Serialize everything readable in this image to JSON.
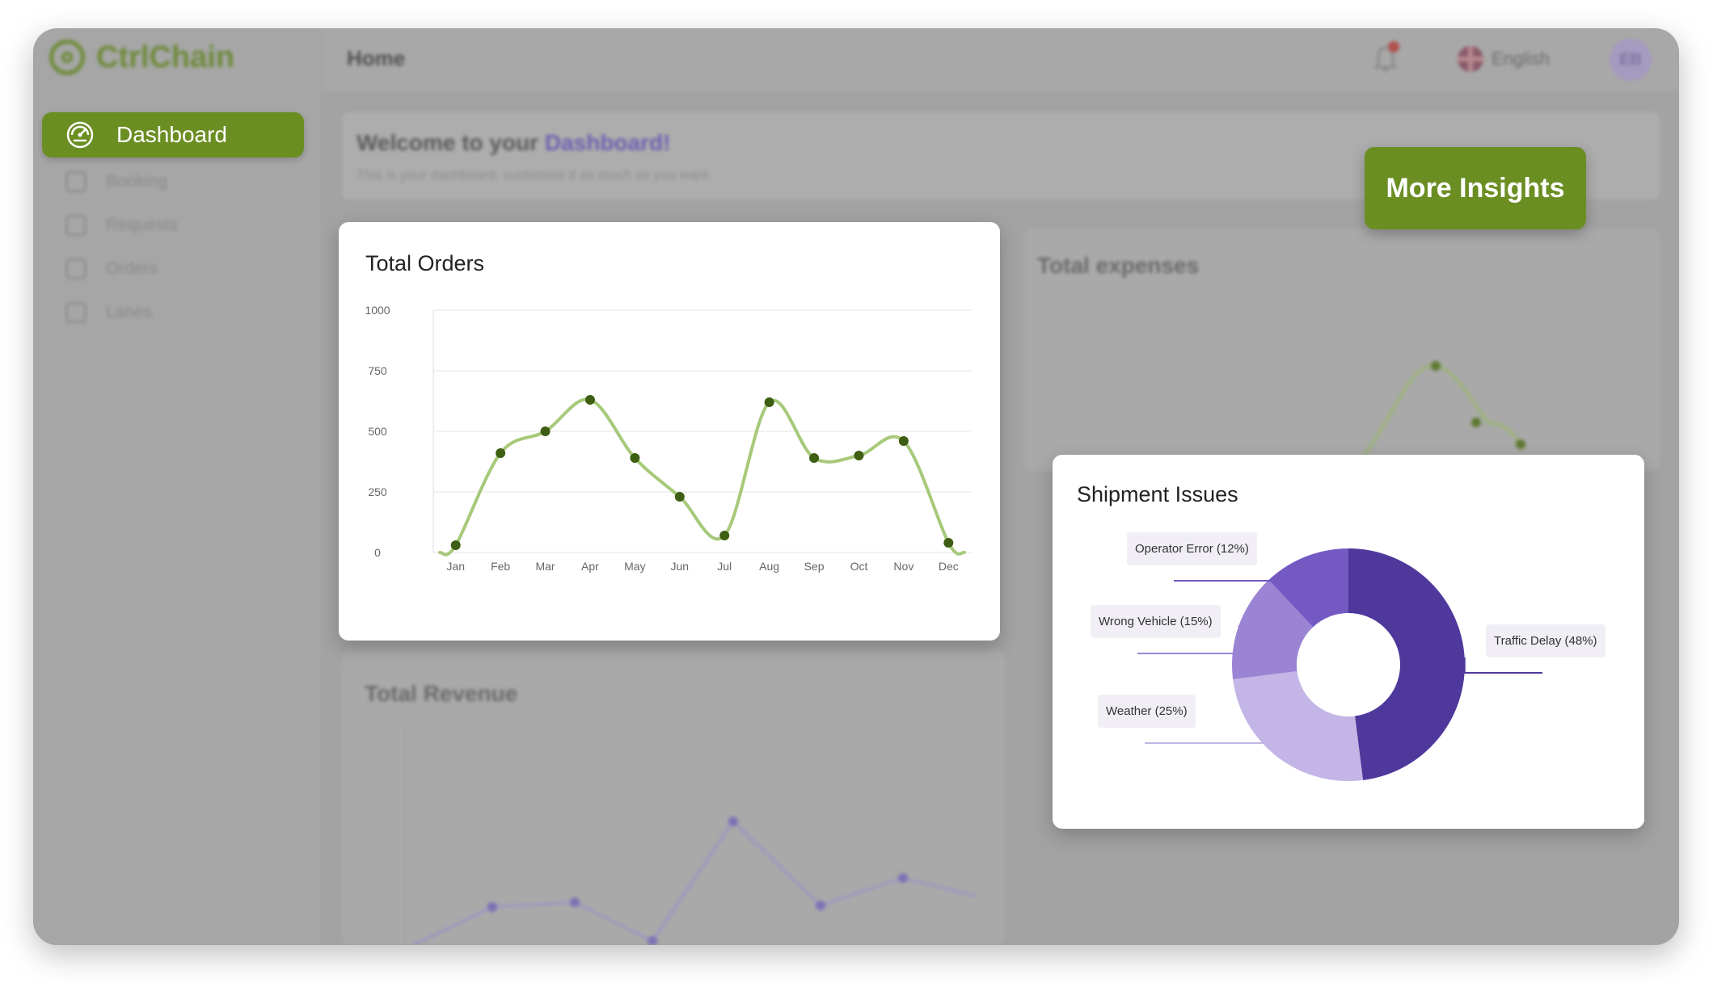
{
  "app": {
    "brand": "CtrlChain",
    "page_title": "Home"
  },
  "header": {
    "language": "English",
    "avatar_initials": "EB"
  },
  "sidebar": {
    "active_item": "Dashboard",
    "items": [
      {
        "label": "Booking",
        "icon": "calendar-icon"
      },
      {
        "label": "Requests",
        "icon": "inbox-icon"
      },
      {
        "label": "Orders",
        "icon": "clipboard-icon"
      },
      {
        "label": "Lanes",
        "icon": "route-icon"
      }
    ]
  },
  "welcome": {
    "title_prefix": "Welcome to your ",
    "title_accent": "Dashboard!",
    "subtitle": "This is your dashboard, customise it as much as you want."
  },
  "actions": {
    "more_insights": "More Insights"
  },
  "background_panels": {
    "expenses_title": "Total expenses",
    "revenue_title": "Total Revenue"
  },
  "colors": {
    "brand_green": "#6b8e23",
    "line_green": "#a7c97a",
    "marker_green": "#3e5f13",
    "purple_dark": "#4f389b",
    "purple_mid": "#7459c3",
    "purple_light": "#9a84d3",
    "purple_pale": "#c3b6e6"
  },
  "chart_data": [
    {
      "type": "line",
      "title": "Total Orders",
      "categories": [
        "Jan",
        "Feb",
        "Mar",
        "Apr",
        "May",
        "Jun",
        "Jul",
        "Aug",
        "Sep",
        "Oct",
        "Nov",
        "Dec"
      ],
      "values": [
        30,
        410,
        500,
        630,
        390,
        230,
        70,
        620,
        390,
        400,
        460,
        40
      ],
      "ylim": [
        0,
        1000
      ],
      "yticks": [
        0,
        250,
        500,
        750,
        1000
      ],
      "grid": true,
      "smooth": true
    },
    {
      "type": "pie",
      "title": "Shipment Issues",
      "donut": true,
      "slices": [
        {
          "label": "Traffic Delay (48%)",
          "value": 48
        },
        {
          "label": "Weather (25%)",
          "value": 25
        },
        {
          "label": "Wrong Vehicle (15%)",
          "value": 15
        },
        {
          "label": "Operator Error (12%)",
          "value": 12
        }
      ]
    }
  ]
}
